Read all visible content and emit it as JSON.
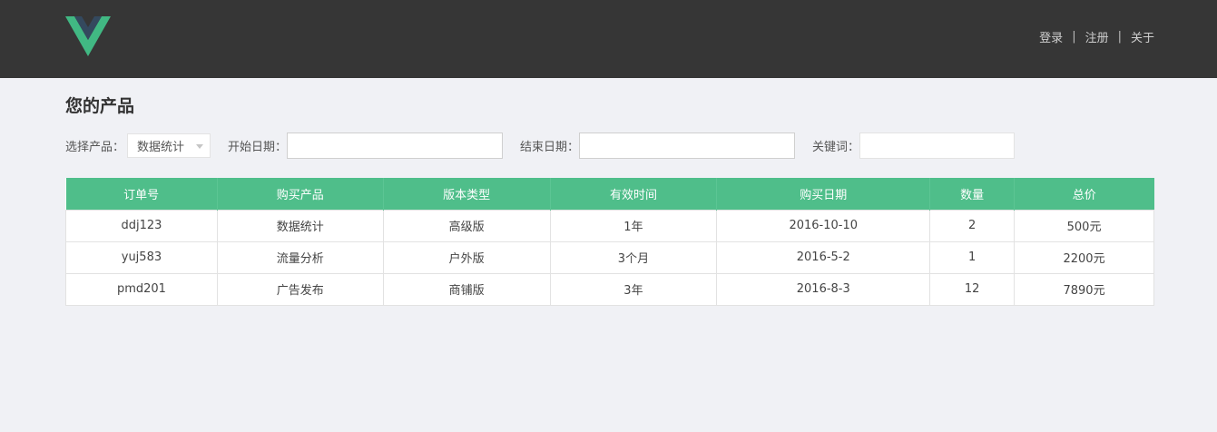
{
  "header": {
    "nav": [
      {
        "label": "登录",
        "name": "nav-login"
      },
      {
        "label": "注册",
        "name": "nav-register"
      },
      {
        "label": "关于",
        "name": "nav-about"
      }
    ],
    "separator": "|"
  },
  "main": {
    "title": "您的产品",
    "filters": {
      "product_label": "选择产品：",
      "product_value": "数据统计",
      "start_label": "开始日期：",
      "start_value": "",
      "end_label": "结束日期：",
      "end_value": "",
      "keyword_label": "关键词：",
      "keyword_value": ""
    },
    "table": {
      "headers": [
        "订单号",
        "购买产品",
        "版本类型",
        "有效时间",
        "购买日期",
        "数量",
        "总价"
      ],
      "rows": [
        [
          "ddj123",
          "数据统计",
          "高级版",
          "1年",
          "2016-10-10",
          "2",
          "500元"
        ],
        [
          "yuj583",
          "流量分析",
          "户外版",
          "3个月",
          "2016-5-2",
          "1",
          "2200元"
        ],
        [
          "pmd201",
          "广告发布",
          "商铺版",
          "3年",
          "2016-8-3",
          "12",
          "7890元"
        ]
      ]
    }
  },
  "colors": {
    "header_bg": "#363636",
    "table_header": "#4fbe8a",
    "logo_green": "#41b883",
    "logo_dark": "#34495e",
    "page_bg": "#f0f1f5"
  }
}
